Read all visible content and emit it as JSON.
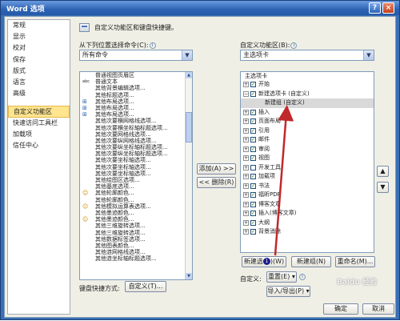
{
  "window": {
    "title": "Word 选项",
    "help": "?",
    "close": "×"
  },
  "nav": {
    "items": [
      "常规",
      "显示",
      "校对",
      "保存",
      "版式",
      "语言",
      "高级",
      "自定义功能区",
      "快速访问工具栏",
      "加载项",
      "信任中心"
    ],
    "selected_index": 7
  },
  "header": {
    "title": "自定义功能区和键盘快捷键。"
  },
  "left": {
    "choose_label": "从下列位置选择命令(C):",
    "choose_value": "所有命令",
    "commands": [
      {
        "icon": "",
        "text": "普通视图页眉区"
      },
      {
        "icon": "abc",
        "text": "普通文本"
      },
      {
        "icon": "",
        "text": "其他背景编辑选项..."
      },
      {
        "icon": "",
        "text": "其他标题选项..."
      },
      {
        "icon": "grid",
        "text": "其他布局选项..."
      },
      {
        "icon": "grid",
        "text": "其他布局选项..."
      },
      {
        "icon": "grid",
        "text": "其他布局选项..."
      },
      {
        "icon": "",
        "text": "其他次要横网格线选项..."
      },
      {
        "icon": "",
        "text": "其他次要横坐标轴标题选项..."
      },
      {
        "icon": "",
        "text": "其他次要网格线选项..."
      },
      {
        "icon": "",
        "text": "其他次要纵网格线选项..."
      },
      {
        "icon": "",
        "text": "其他次要纵坐标轴标题选项..."
      },
      {
        "icon": "",
        "text": "其他次要纵坐标轴标题选项..."
      },
      {
        "icon": "",
        "text": "其他次要坐标轴选项..."
      },
      {
        "icon": "",
        "text": "其他次要坐标轴选项..."
      },
      {
        "icon": "",
        "text": "其他次要坐标轴选项..."
      },
      {
        "icon": "",
        "text": "其他绘图区选项..."
      },
      {
        "icon": "",
        "text": "其他基底选项..."
      },
      {
        "icon": "face",
        "text": "其他轮廓颜色..."
      },
      {
        "icon": "",
        "text": "其他轮廓颜色..."
      },
      {
        "icon": "face",
        "text": "其他模拟运算表选项..."
      },
      {
        "icon": "",
        "text": "其他墨迹颜色..."
      },
      {
        "icon": "face",
        "text": "其他墨迹颜色..."
      },
      {
        "icon": "",
        "text": "其他三维旋转选项..."
      },
      {
        "icon": "",
        "text": "其他三维旋转选项..."
      },
      {
        "icon": "",
        "text": "其他数据标签选项..."
      },
      {
        "icon": "",
        "text": "其他图表颜色..."
      },
      {
        "icon": "",
        "text": "其他涟网格线选项..."
      },
      {
        "icon": "",
        "text": "其他涟坐标轴标题选项..."
      }
    ],
    "keyboard_label": "键盘快捷方式:",
    "keyboard_button": "自定义(T)..."
  },
  "middle": {
    "add_button": "添加(A) >>",
    "remove_button": "<< 删除(R)"
  },
  "right": {
    "customize_label": "自定义功能区(B):",
    "customize_value": "主选项卡",
    "tree_header": "主选项卡",
    "tree": [
      {
        "exp": "+",
        "checked": true,
        "text": "开始",
        "child": false
      },
      {
        "exp": "-",
        "checked": true,
        "text": "新建选项卡 (自定义)",
        "child": false
      },
      {
        "exp": "",
        "checked": false,
        "text": "新建组 (自定义)",
        "child": true,
        "hl": true
      },
      {
        "exp": "+",
        "checked": true,
        "text": "插入",
        "child": false
      },
      {
        "exp": "+",
        "checked": true,
        "text": "页面布局",
        "child": false
      },
      {
        "exp": "+",
        "checked": true,
        "text": "引用",
        "child": false
      },
      {
        "exp": "+",
        "checked": true,
        "text": "邮件",
        "child": false
      },
      {
        "exp": "+",
        "checked": true,
        "text": "审阅",
        "child": false
      },
      {
        "exp": "+",
        "checked": true,
        "text": "视图",
        "child": false
      },
      {
        "exp": "+",
        "checked": false,
        "text": "开发工具",
        "child": false
      },
      {
        "exp": "+",
        "checked": true,
        "text": "加载项",
        "child": false
      },
      {
        "exp": "+",
        "checked": true,
        "text": "书法",
        "child": false
      },
      {
        "exp": "+",
        "checked": true,
        "text": "福昕PDF",
        "child": false
      },
      {
        "exp": "+",
        "checked": true,
        "text": "博客文章",
        "child": false
      },
      {
        "exp": "+",
        "checked": true,
        "text": "插入(博客文章)",
        "child": false
      },
      {
        "exp": "+",
        "checked": true,
        "text": "大纲",
        "child": false
      },
      {
        "exp": "+",
        "checked": true,
        "text": "背景消除",
        "child": false
      }
    ],
    "new_tab_button_pre": "新建选",
    "new_tab_button_badge": "1",
    "new_tab_button_post": ")(W)",
    "new_group_button": "新建组(N)",
    "rename_button": "重命名(M)...",
    "customizations_label": "自定义:",
    "reset_button": "重置(E) ▾",
    "import_export_button": "导入/导出(P) ▾",
    "up_arrow": "▲",
    "down_arrow": "▼"
  },
  "footer": {
    "ok": "确定",
    "cancel": "取消"
  },
  "watermark": "Baidu 经验",
  "colors": {
    "title_bar": "#2d63b3",
    "nav_selected": "#ffe58e",
    "annotation_arrow": "#c0292b"
  }
}
